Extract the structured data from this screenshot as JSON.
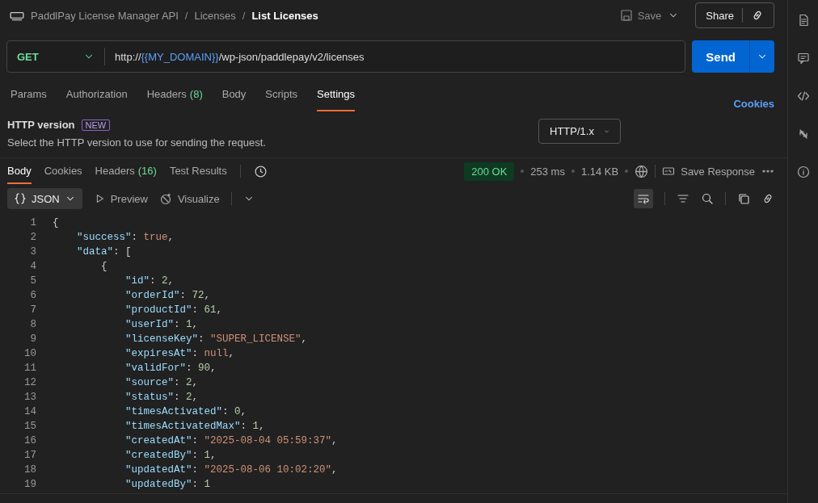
{
  "breadcrumb": {
    "items": [
      "PaddlPay License Manager API",
      "Licenses"
    ],
    "current": "List Licenses",
    "separator": "/"
  },
  "actions": {
    "save": "Save",
    "share": "Share"
  },
  "request": {
    "method": "GET",
    "url_parts": [
      {
        "kind": "plain",
        "text": "http://"
      },
      {
        "kind": "variable",
        "text": "{{MY_DOMAIN}}"
      },
      {
        "kind": "plain",
        "text": "/wp-json/paddlepay/v2/licenses"
      }
    ],
    "send": "Send"
  },
  "request_tabs": [
    {
      "label": "Params",
      "selected": false
    },
    {
      "label": "Authorization",
      "selected": false
    },
    {
      "label": "Headers",
      "count": "(8)",
      "selected": false
    },
    {
      "label": "Body",
      "selected": false
    },
    {
      "label": "Scripts",
      "selected": false
    },
    {
      "label": "Settings",
      "selected": true
    }
  ],
  "cookies_link": "Cookies",
  "setting": {
    "title": "HTTP version",
    "badge": "NEW",
    "description": "Select the HTTP version to use for sending the request.",
    "value": "HTTP/1.x"
  },
  "response_tabs": [
    {
      "label": "Body",
      "selected": true
    },
    {
      "label": "Cookies",
      "selected": false
    },
    {
      "label": "Headers",
      "count": "(16)",
      "selected": false
    },
    {
      "label": "Test Results",
      "selected": false
    }
  ],
  "response_meta": {
    "status": "200 OK",
    "time": "253 ms",
    "size": "1.14 KB",
    "save_response": "Save Response"
  },
  "format": {
    "selected": "JSON",
    "preview": "Preview",
    "visualize": "Visualize"
  },
  "code_lines": [
    {
      "number": "1",
      "tokens": [
        {
          "kind": "punct",
          "text": "{"
        }
      ]
    },
    {
      "number": "2",
      "tokens": [
        {
          "kind": "key",
          "text": "    \"success\""
        },
        {
          "kind": "punct",
          "text": ": "
        },
        {
          "kind": "keyword",
          "text": "true"
        },
        {
          "kind": "punct",
          "text": ","
        }
      ]
    },
    {
      "number": "3",
      "tokens": [
        {
          "kind": "key",
          "text": "    \"data\""
        },
        {
          "kind": "punct",
          "text": ": ["
        }
      ]
    },
    {
      "number": "4",
      "tokens": [
        {
          "kind": "punct",
          "text": "        {"
        }
      ]
    },
    {
      "number": "5",
      "tokens": [
        {
          "kind": "key",
          "text": "            \"id\""
        },
        {
          "kind": "punct",
          "text": ": "
        },
        {
          "kind": "number",
          "text": "2"
        },
        {
          "kind": "punct",
          "text": ","
        }
      ]
    },
    {
      "number": "6",
      "tokens": [
        {
          "kind": "key",
          "text": "            \"orderId\""
        },
        {
          "kind": "punct",
          "text": ": "
        },
        {
          "kind": "number",
          "text": "72"
        },
        {
          "kind": "punct",
          "text": ","
        }
      ]
    },
    {
      "number": "7",
      "tokens": [
        {
          "kind": "key",
          "text": "            \"productId\""
        },
        {
          "kind": "punct",
          "text": ": "
        },
        {
          "kind": "number",
          "text": "61"
        },
        {
          "kind": "punct",
          "text": ","
        }
      ]
    },
    {
      "number": "8",
      "tokens": [
        {
          "kind": "key",
          "text": "            \"userId\""
        },
        {
          "kind": "punct",
          "text": ": "
        },
        {
          "kind": "number",
          "text": "1"
        },
        {
          "kind": "punct",
          "text": ","
        }
      ]
    },
    {
      "number": "9",
      "tokens": [
        {
          "kind": "key",
          "text": "            \"licenseKey\""
        },
        {
          "kind": "punct",
          "text": ": "
        },
        {
          "kind": "string",
          "text": "\"SUPER_LICENSE\""
        },
        {
          "kind": "punct",
          "text": ","
        }
      ]
    },
    {
      "number": "10",
      "tokens": [
        {
          "kind": "key",
          "text": "            \"expiresAt\""
        },
        {
          "kind": "punct",
          "text": ": "
        },
        {
          "kind": "keyword",
          "text": "null"
        },
        {
          "kind": "punct",
          "text": ","
        }
      ]
    },
    {
      "number": "11",
      "tokens": [
        {
          "kind": "key",
          "text": "            \"validFor\""
        },
        {
          "kind": "punct",
          "text": ": "
        },
        {
          "kind": "number",
          "text": "90"
        },
        {
          "kind": "punct",
          "text": ","
        }
      ]
    },
    {
      "number": "12",
      "tokens": [
        {
          "kind": "key",
          "text": "            \"source\""
        },
        {
          "kind": "punct",
          "text": ": "
        },
        {
          "kind": "number",
          "text": "2"
        },
        {
          "kind": "punct",
          "text": ","
        }
      ]
    },
    {
      "number": "13",
      "tokens": [
        {
          "kind": "key",
          "text": "            \"status\""
        },
        {
          "kind": "punct",
          "text": ": "
        },
        {
          "kind": "number",
          "text": "2"
        },
        {
          "kind": "punct",
          "text": ","
        }
      ]
    },
    {
      "number": "14",
      "tokens": [
        {
          "kind": "key",
          "text": "            \"timesActivated\""
        },
        {
          "kind": "punct",
          "text": ": "
        },
        {
          "kind": "number",
          "text": "0"
        },
        {
          "kind": "punct",
          "text": ","
        }
      ]
    },
    {
      "number": "15",
      "tokens": [
        {
          "kind": "key",
          "text": "            \"timesActivatedMax\""
        },
        {
          "kind": "punct",
          "text": ": "
        },
        {
          "kind": "number",
          "text": "1"
        },
        {
          "kind": "punct",
          "text": ","
        }
      ]
    },
    {
      "number": "16",
      "tokens": [
        {
          "kind": "key",
          "text": "            \"createdAt\""
        },
        {
          "kind": "punct",
          "text": ": "
        },
        {
          "kind": "string",
          "text": "\"2025-08-04 05:59:37\""
        },
        {
          "kind": "punct",
          "text": ","
        }
      ]
    },
    {
      "number": "17",
      "tokens": [
        {
          "kind": "key",
          "text": "            \"createdBy\""
        },
        {
          "kind": "punct",
          "text": ": "
        },
        {
          "kind": "number",
          "text": "1"
        },
        {
          "kind": "punct",
          "text": ","
        }
      ]
    },
    {
      "number": "18",
      "tokens": [
        {
          "kind": "key",
          "text": "            \"updatedAt\""
        },
        {
          "kind": "punct",
          "text": ": "
        },
        {
          "kind": "string",
          "text": "\"2025-08-06 10:02:20\""
        },
        {
          "kind": "punct",
          "text": ","
        }
      ]
    },
    {
      "number": "19",
      "tokens": [
        {
          "kind": "key",
          "text": "            \"updatedBy\""
        },
        {
          "kind": "punct",
          "text": ": "
        },
        {
          "kind": "number",
          "text": "1"
        }
      ]
    }
  ]
}
